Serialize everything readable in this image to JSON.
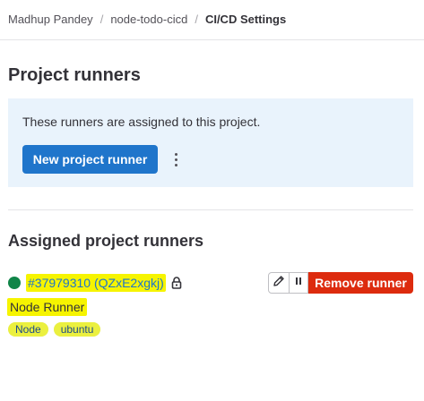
{
  "breadcrumb": {
    "items": [
      "Madhup Pandey",
      "node-todo-cicd",
      "CI/CD Settings"
    ],
    "separator": "/"
  },
  "project_runners": {
    "title": "Project runners",
    "info_text": "These runners are assigned to this project.",
    "new_button_label": "New project runner"
  },
  "assigned": {
    "title": "Assigned project runners",
    "runner": {
      "id_label": "#37979310 (QZxE2xgkj)",
      "name": "Node Runner",
      "tags": [
        "Node",
        "ubuntu"
      ],
      "status_color": "#108548",
      "remove_label": "Remove runner"
    }
  },
  "icons": [
    "lock-icon",
    "pencil-icon",
    "pause-icon",
    "kebab-menu-icon"
  ],
  "colors": {
    "primary": "#1f75cb",
    "danger": "#dd2b0e",
    "info_bg": "#e9f3fc",
    "highlight": "#f6f400"
  }
}
